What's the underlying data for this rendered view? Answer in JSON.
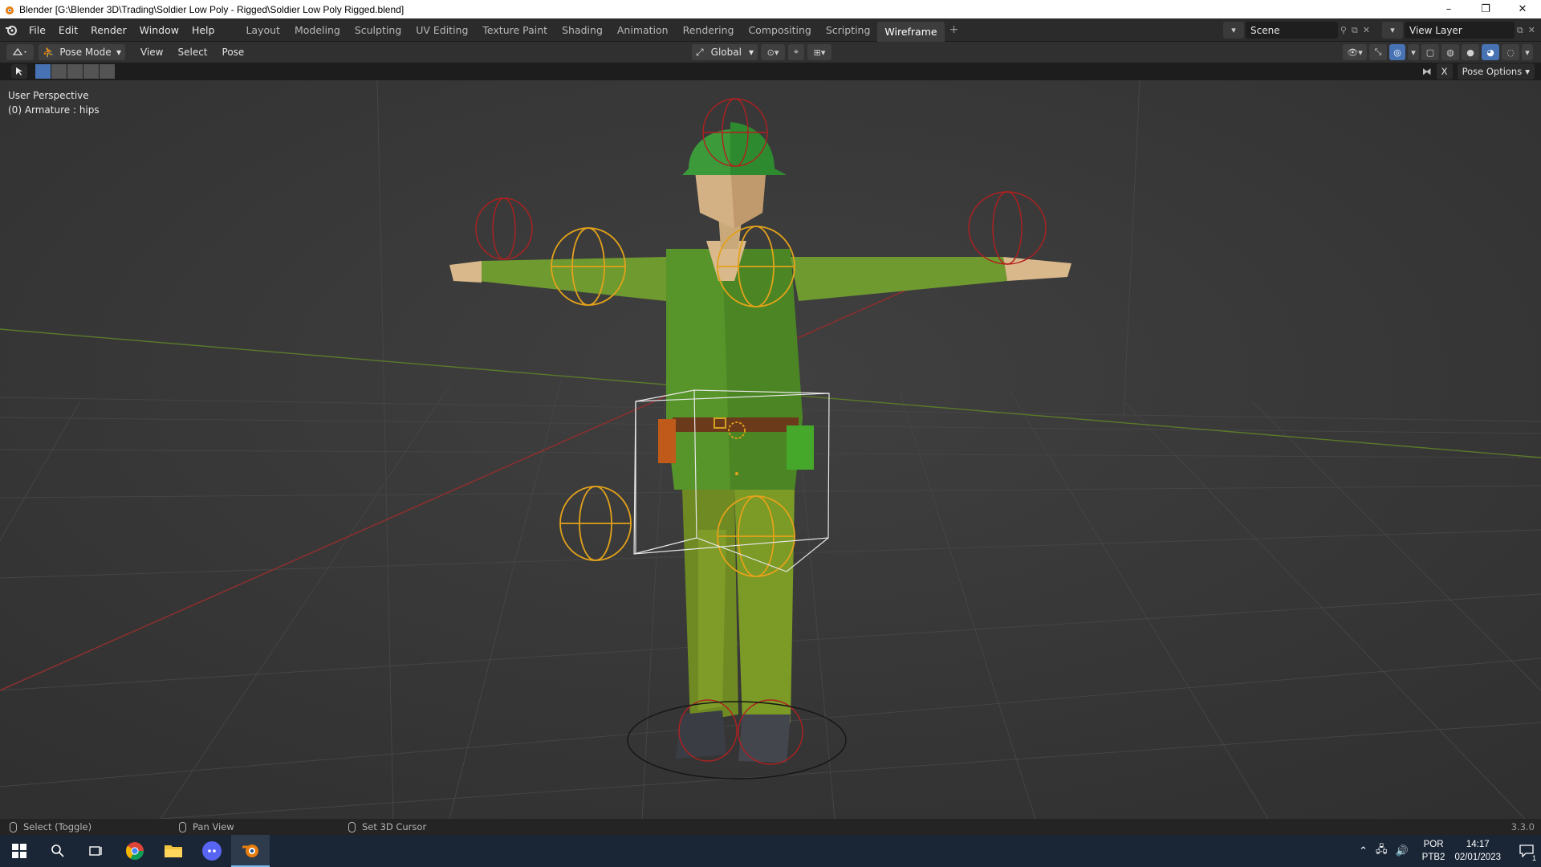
{
  "window": {
    "title": "Blender [G:\\Blender 3D\\Trading\\Soldier Low Poly - Rigged\\Soldier Low Poly Rigged.blend]",
    "minimize": "–",
    "maximize": "❐",
    "close": "✕"
  },
  "menu": [
    "File",
    "Edit",
    "Render",
    "Window",
    "Help"
  ],
  "workspaces": [
    "Layout",
    "Modeling",
    "Sculpting",
    "UV Editing",
    "Texture Paint",
    "Shading",
    "Animation",
    "Rendering",
    "Compositing",
    "Scripting",
    "Wireframe"
  ],
  "active_workspace": "Wireframe",
  "add_workspace": "+",
  "scene": {
    "label": "Scene"
  },
  "view_layer": {
    "label": "View Layer"
  },
  "viewport_header": {
    "mode": "Pose Mode",
    "menus": [
      "View",
      "Select",
      "Pose"
    ],
    "orientation": "Global"
  },
  "tool_header": {
    "pose_options": "Pose Options",
    "x_mirror": "X"
  },
  "viewport": {
    "perspective": "User Perspective",
    "active_object": "(0) Armature : hips"
  },
  "statusbar": {
    "hint_left": "Select (Toggle)",
    "hint_middle": "Pan View",
    "hint_right": "Set 3D Cursor",
    "version": "3.3.0"
  },
  "taskbar": {
    "language": "POR",
    "layout": "PTB2",
    "time": "14:17",
    "date": "02/01/2023",
    "notifications": "1"
  },
  "colors": {
    "accent": "#4772b3",
    "viewport_bg": "#393939",
    "uniform_green": "#5a9a2a",
    "bone_yellow": "#e3a21a",
    "bone_red": "#b02020"
  }
}
